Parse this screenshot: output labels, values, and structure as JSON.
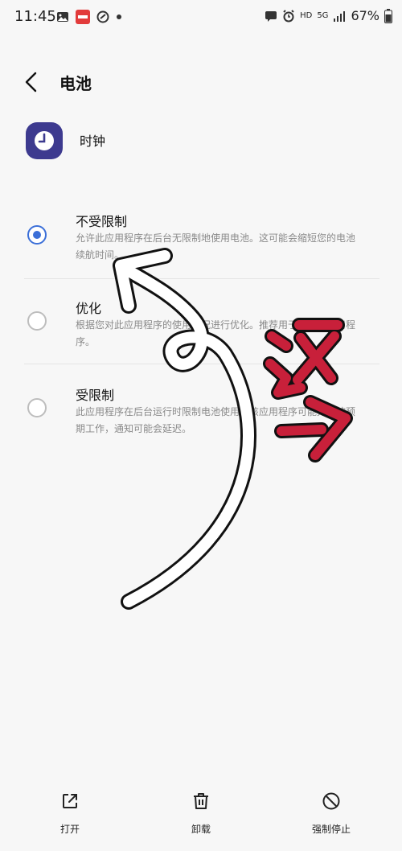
{
  "status_bar": {
    "time": "11:45",
    "network": "5G",
    "hd": "HD",
    "battery": "67%"
  },
  "header": {
    "title": "电池"
  },
  "app": {
    "name": "时钟"
  },
  "options": [
    {
      "title": "不受限制",
      "description": "允许此应用程序在后台无限制地使用电池。这可能会缩短您的电池续航时间。",
      "selected": true
    },
    {
      "title": "优化",
      "description": "根据您对此应用程序的使用情况进行优化。推荐用于大多数应用程序。",
      "selected": false
    },
    {
      "title": "受限制",
      "description": "此应用程序在后台运行时限制电池使用。该应用程序可能无法按预期工作，通知可能会延迟。",
      "selected": false
    }
  ],
  "bottom_bar": {
    "open_label": "打开",
    "uninstall_label": "卸载",
    "force_stop_label": "强制停止"
  },
  "annotation": {
    "text": "这个"
  },
  "colors": {
    "accent": "#3b6fd8",
    "annotation_red": "#c8203a"
  }
}
